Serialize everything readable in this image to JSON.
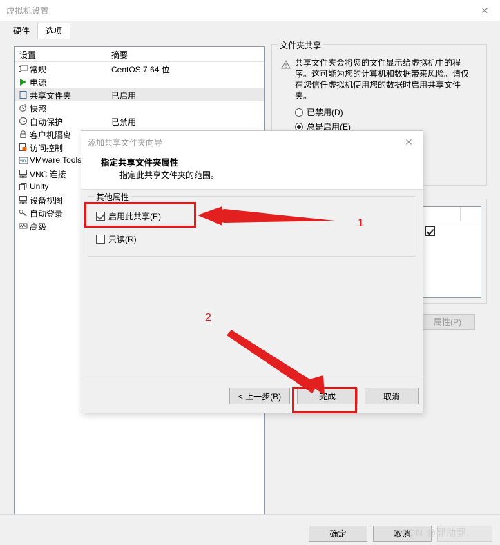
{
  "window": {
    "title": "虚拟机设置",
    "close_icon": "close-icon"
  },
  "tabs": [
    {
      "label": "硬件",
      "selected": false
    },
    {
      "label": "选项",
      "selected": true
    }
  ],
  "settings_list": {
    "columns": [
      "设置",
      "摘要"
    ],
    "rows": [
      {
        "icon": "monitor-icon",
        "label": "常规",
        "value": "CentOS 7 64 位",
        "selected": false
      },
      {
        "icon": "play-icon",
        "label": "电源",
        "value": "",
        "selected": false
      },
      {
        "icon": "folder-icon",
        "label": "共享文件夹",
        "value": "已启用",
        "selected": true
      },
      {
        "icon": "camera-icon",
        "label": "快照",
        "value": "",
        "selected": false
      },
      {
        "icon": "clock-icon",
        "label": "自动保护",
        "value": "已禁用",
        "selected": false
      },
      {
        "icon": "lock-icon",
        "label": "客户机隔离",
        "value": "",
        "selected": false
      },
      {
        "icon": "shield-icon",
        "label": "访问控制",
        "value": "",
        "selected": false
      },
      {
        "icon": "vm-icon",
        "label": "VMware Tools",
        "value": "",
        "selected": false
      },
      {
        "icon": "network-icon",
        "label": "VNC 连接",
        "value": "",
        "selected": false
      },
      {
        "icon": "unity-icon",
        "label": "Unity",
        "value": "",
        "selected": false
      },
      {
        "icon": "device-icon",
        "label": "设备视图",
        "value": "",
        "selected": false
      },
      {
        "icon": "key-icon",
        "label": "自动登录",
        "value": "",
        "selected": false
      },
      {
        "icon": "advanced-icon",
        "label": "高级",
        "value": "",
        "selected": false
      }
    ]
  },
  "right_panel": {
    "folder_sharing": {
      "group_title": "文件夹共享",
      "warning_icon": "warning-icon",
      "warning_text": "共享文件夹会将您的文件显示给虚拟机中的程序。这可能为您的计算机和数据带来风险。请仅在您信任虚拟机使用您的数据时启用共享文件夹。",
      "options": [
        {
          "label": "已禁用(D)",
          "checked": false
        },
        {
          "label": "总是启用(E)",
          "checked": true
        },
        {
          "label": ")",
          "checked": false
        }
      ]
    },
    "folders": {
      "group_title": "",
      "properties_button": "属性(P)"
    }
  },
  "main_buttons": {
    "ok": "确定",
    "cancel": "取消",
    "help": ""
  },
  "watermark": "CSDN @郭助郭.",
  "wizard": {
    "title": "添加共享文件夹向导",
    "close_icon": "close-icon",
    "heading": "指定共享文件夹属性",
    "subheading": "指定此共享文件夹的范围。",
    "group_title": "其他属性",
    "checkboxes": [
      {
        "label": "启用此共享(E)",
        "checked": true
      },
      {
        "label": "只读(R)",
        "checked": false
      }
    ],
    "buttons": {
      "back": "< 上一步(B)",
      "finish": "完成",
      "cancel": "取消"
    }
  },
  "annotations": {
    "step_1": "1",
    "step_2": "2",
    "highlight_color": "#e01b1b"
  }
}
